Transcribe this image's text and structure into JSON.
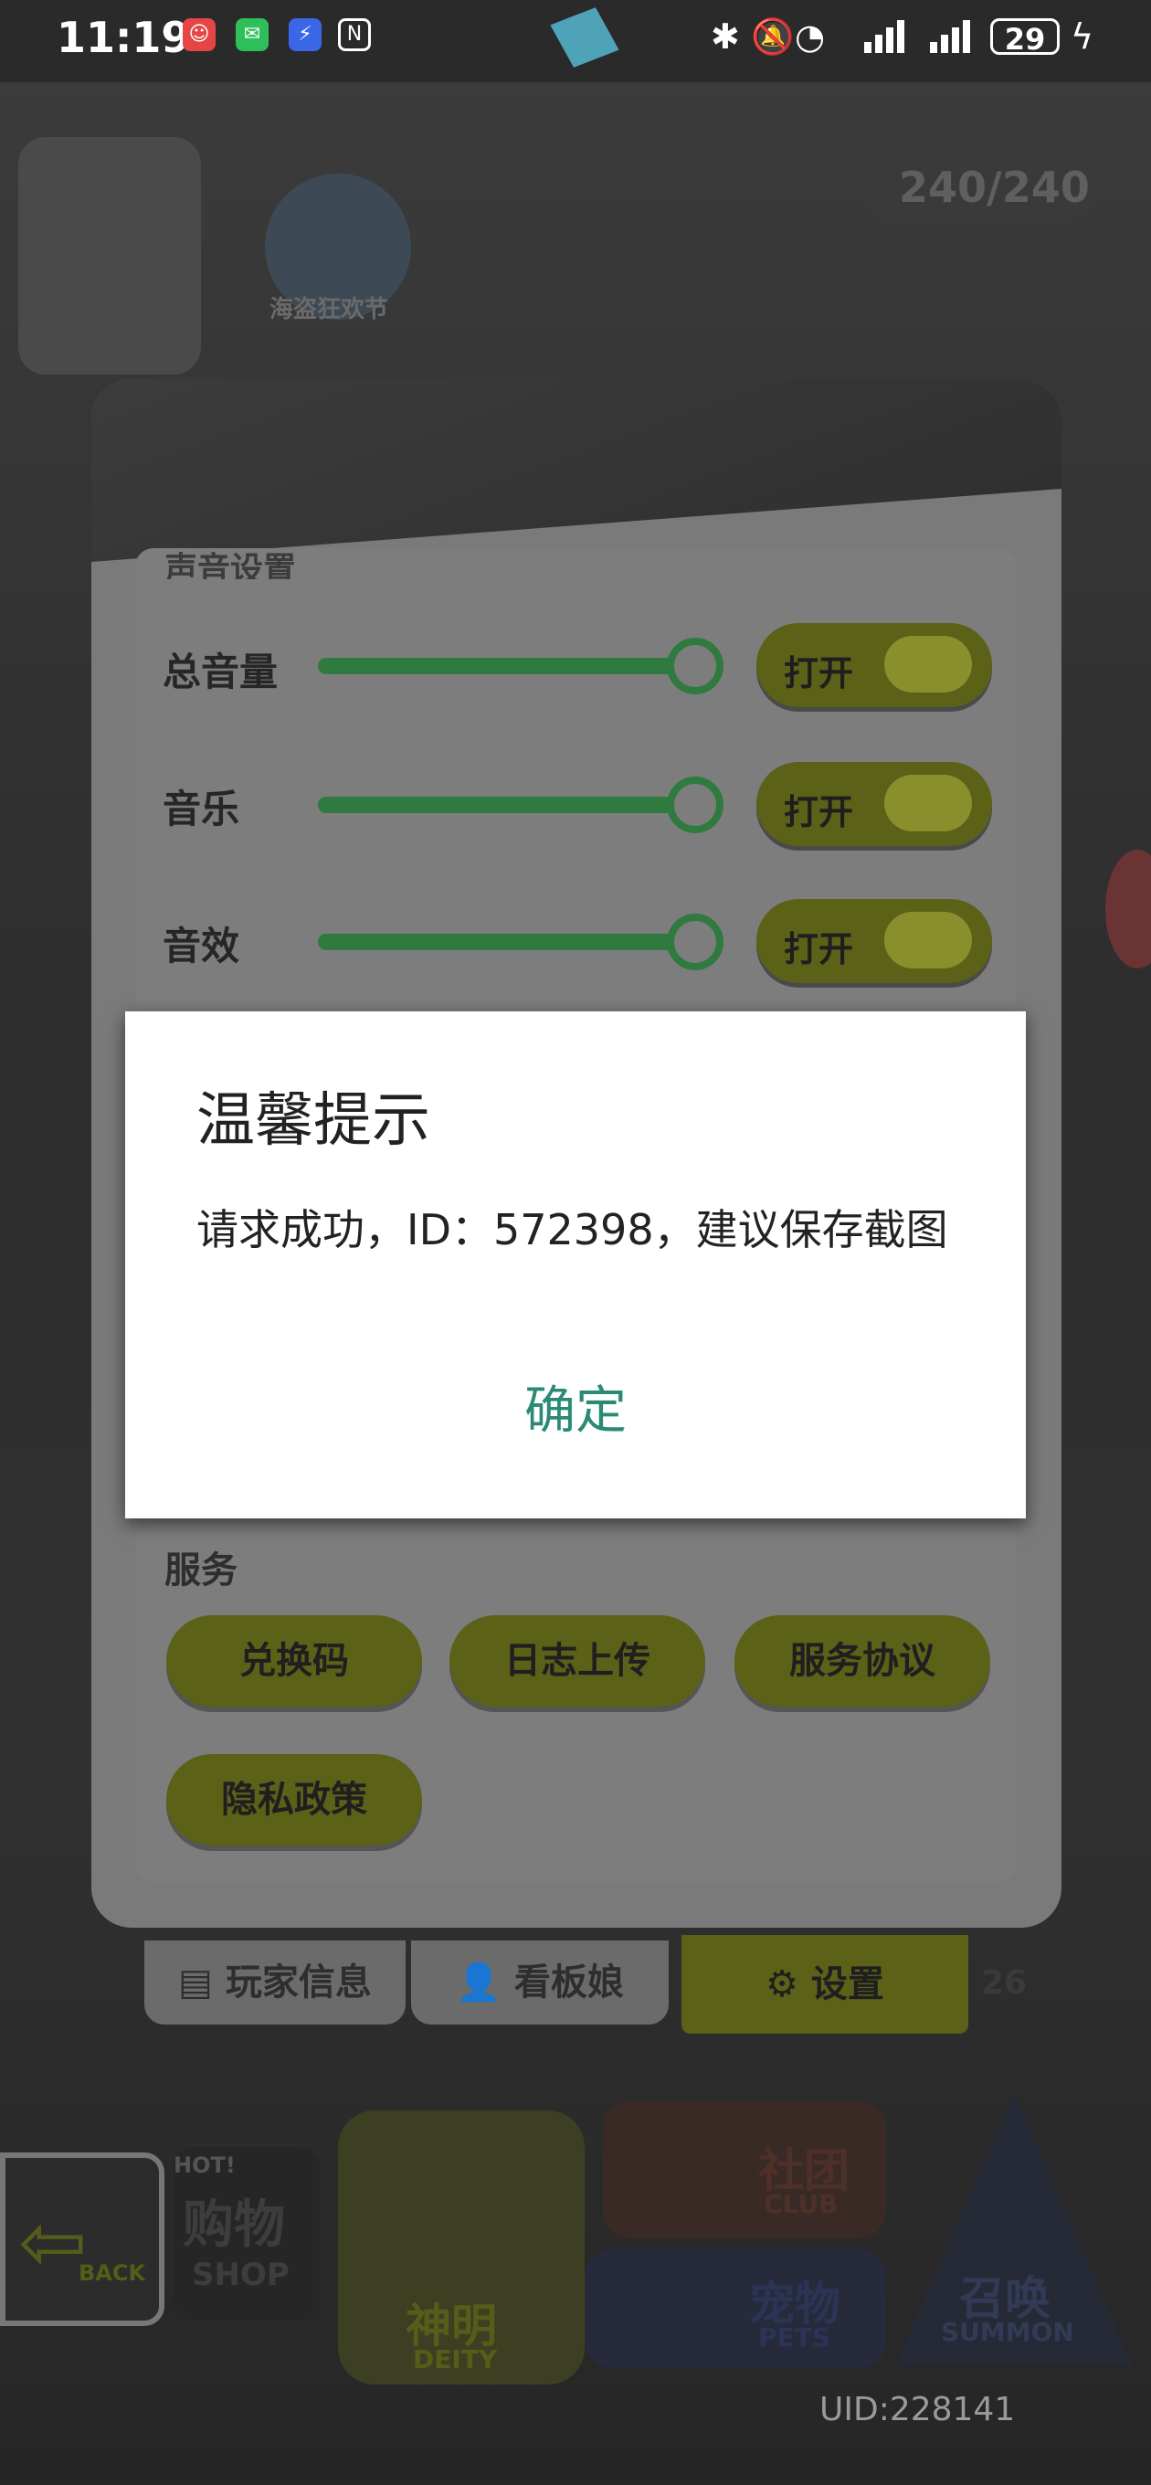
{
  "status_bar": {
    "time": "11:19",
    "battery": "29"
  },
  "top_hud": {
    "energy": "240/240",
    "event_label": "海盗狂欢节"
  },
  "settings": {
    "sound_section_title": "声音设置",
    "rows": [
      {
        "label": "总音量",
        "toggle_label": "打开",
        "level": 1.0
      },
      {
        "label": "音乐",
        "toggle_label": "打开",
        "level": 1.0
      },
      {
        "label": "音效",
        "toggle_label": "打开",
        "level": 1.0
      }
    ],
    "service_section_title": "服务",
    "service_buttons": [
      "兑换码",
      "日志上传",
      "服务协议",
      "隐私政策"
    ]
  },
  "bottom_tabs": {
    "player_info": "玩家信息",
    "mascot": "看板娘",
    "settings": "设置",
    "side_number": "26"
  },
  "bottom_menu": {
    "back": "BACK",
    "shop_cn": "购物",
    "shop_en": "SHOP",
    "deity_cn": "神明",
    "deity_en": "DEITY",
    "club_cn": "社团",
    "club_en": "CLUB",
    "pets_cn": "宠物",
    "pets_en": "PETS",
    "summon_cn": "召唤",
    "summon_en": "SUMMON",
    "hot": "HOT!"
  },
  "dialog": {
    "title": "温馨提示",
    "message": "请求成功，ID：572398，建议保存截图",
    "ok_label": "确定"
  },
  "uid_text": "UID:228141",
  "colors": {
    "dialog_ok": "#2a8a76",
    "slider": "#2f7a3f",
    "toggle_bg": "#5c6118"
  }
}
